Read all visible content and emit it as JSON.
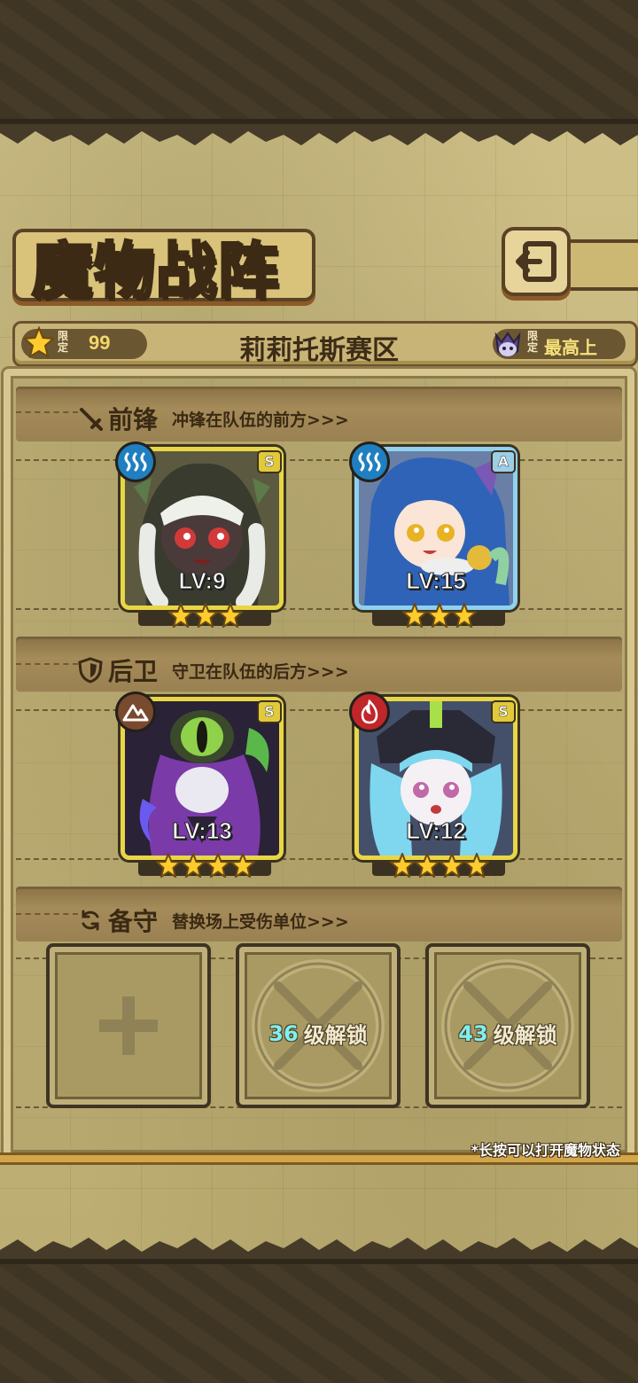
{
  "title": "魔物战阵",
  "header": {
    "limit_left_tag": "限定",
    "limit_left_value": "99",
    "region_name": "莉莉托斯赛区",
    "limit_right_tag": "限定",
    "limit_right_text": "最高上"
  },
  "sections": {
    "vanguard": {
      "title": "前锋",
      "subtitle": "冲锋在队伍的前方>>>"
    },
    "rearguard": {
      "title": "后卫",
      "subtitle": "守卫在队伍的后方>>>"
    },
    "reserve": {
      "title": "备守",
      "subtitle": "替换场上受伤单位>>>"
    }
  },
  "cards": [
    {
      "level_text": "LV:9",
      "rank": "S",
      "element": "water",
      "stars": 3,
      "frame": "gold"
    },
    {
      "level_text": "LV:15",
      "rank": "A",
      "element": "water",
      "stars": 3,
      "frame": "blue"
    },
    {
      "level_text": "LV:13",
      "rank": "S",
      "element": "earth",
      "stars": 4,
      "frame": "gold"
    },
    {
      "level_text": "LV:12",
      "rank": "S",
      "element": "fire",
      "stars": 4,
      "frame": "gold"
    }
  ],
  "reserve_slots": [
    {
      "type": "add",
      "icon": "plus-icon"
    },
    {
      "type": "locked",
      "level": "36",
      "label": "级解锁"
    },
    {
      "type": "locked",
      "level": "43",
      "label": "级解锁"
    }
  ],
  "hint": "*长按可以打开魔物状态",
  "colors": {
    "parchment": "#c4b57b",
    "frame_gold": "#e8d646",
    "frame_blue": "#8fd1ee",
    "water": "#1f7fc0",
    "earth": "#7a4a2e",
    "fire": "#c0262a",
    "star": "#ffcc2e"
  }
}
